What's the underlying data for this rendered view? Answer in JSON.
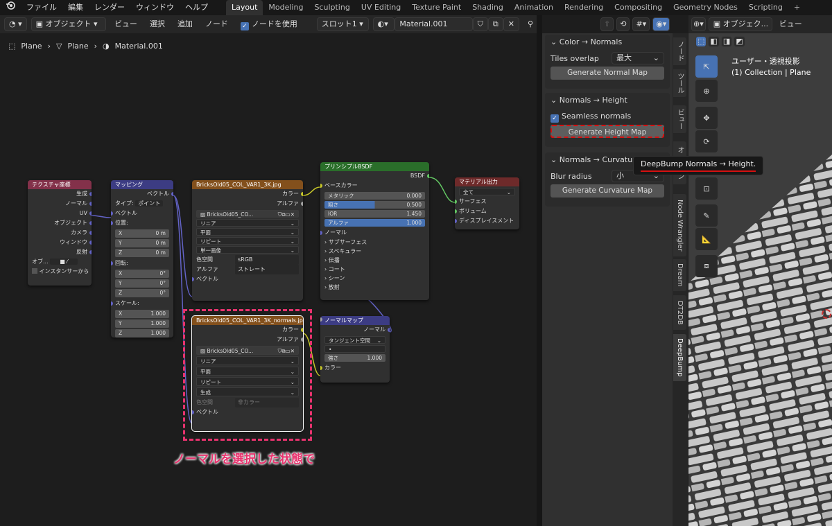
{
  "menu": [
    "ファイル",
    "編集",
    "レンダー",
    "ウィンドウ",
    "ヘルプ"
  ],
  "workspaces": [
    "Layout",
    "Modeling",
    "Sculpting",
    "UV Editing",
    "Texture Paint",
    "Shading",
    "Animation",
    "Rendering",
    "Compositing",
    "Geometry Nodes",
    "Scripting",
    "+"
  ],
  "header": {
    "mode": "オブジェクト",
    "view": "ビュー",
    "select": "選択",
    "add": "追加",
    "node": "ノード",
    "use_nodes": "ノードを使用",
    "slot": "スロット1",
    "material": "Material.001"
  },
  "breadcrumb": [
    "Plane",
    "Plane",
    "Material.001"
  ],
  "nodes": {
    "texcoord": {
      "title": "テクスチャ座標",
      "outputs": [
        "生成",
        "ノーマル",
        "UV",
        "オブジェクト",
        "カメラ",
        "ウィンドウ",
        "反射"
      ],
      "obj": "オブ...",
      "instancer": "インスタンサーから"
    },
    "mapping": {
      "title": "マッピング",
      "out": "ベクトル",
      "type_label": "タイプ:",
      "type_value": "ポイント",
      "vector": "ベクトル",
      "location": "位置:",
      "rotation": "回転:",
      "scale": "スケール:",
      "axes": [
        "X",
        "Y",
        "Z"
      ],
      "loc_vals": [
        "0 m",
        "0 m",
        "0 m"
      ],
      "rot_vals": [
        "0°",
        "0°",
        "0°"
      ],
      "scale_vals": [
        "1.000",
        "1.000",
        "1.000"
      ]
    },
    "img1": {
      "title": "BricksOld05_COL_VAR1_3K.jpg",
      "out_color": "カラー",
      "out_alpha": "アルファ",
      "file": "BricksOld05_CO...",
      "interp": "リニア",
      "proj": "平面",
      "ext": "リピート",
      "source": "単一画像",
      "cs_label": "色空間",
      "cs_value": "sRGB",
      "alpha_label": "アルファ",
      "alpha_value": "ストレート",
      "vector": "ベクトル"
    },
    "bsdf": {
      "title": "プリンシプルBSDF",
      "out": "BSDF",
      "base_color": "ベースカラー",
      "metallic": "メタリック",
      "metallic_v": "0.000",
      "rough": "粗さ",
      "rough_v": "0.500",
      "ior": "IOR",
      "ior_v": "1.450",
      "alpha": "アルファ",
      "alpha_v": "1.000",
      "normal": "ノーマル",
      "subs": [
        "サブサーフェス",
        "スペキュラー",
        "伝播",
        "コート",
        "シーン",
        "放射"
      ]
    },
    "output": {
      "title": "マテリアル出力",
      "target": "全て",
      "surface": "サーフェス",
      "volume": "ボリューム",
      "disp": "ディスプレイスメント"
    },
    "img2": {
      "title": "BricksOld05_COL_VAR1_3K_normals.jpg",
      "out_color": "カラー",
      "out_alpha": "アルファ",
      "file": "BricksOld05_CO...",
      "interp": "リニア",
      "proj": "平面",
      "ext": "リピート",
      "source": "生成",
      "cs_label": "色空間",
      "cs_value": "非カラー",
      "vector": "ベクトル"
    },
    "normalmap": {
      "title": "ノーマルマップ",
      "out": "ノーマル",
      "space": "タンジェント空間",
      "uvmap": "•",
      "strength": "強さ",
      "strength_v": "1.000",
      "color": "カラー"
    }
  },
  "annotation": "ノーマルを選択した状態で",
  "sidebar": {
    "p1": {
      "title": "Color → Normals",
      "tiles_label": "Tiles overlap",
      "tiles_value": "最大",
      "button": "Generate Normal Map"
    },
    "p2": {
      "title": "Normals → Height",
      "seamless": "Seamless normals",
      "button": "Generate Height Map"
    },
    "p3": {
      "title": "Normals → Curvature",
      "blur_label": "Blur radius",
      "blur_value": "小",
      "button": "Generate Curvature Map"
    }
  },
  "tooltip": "DeepBump Normals → Height.",
  "tabs": [
    "ノード",
    "ツール",
    "ビュー",
    "オ",
    "ン",
    "Node Wrangler",
    "Dream",
    "DT2DB",
    "DeepBump"
  ],
  "viewport": {
    "mode": "オブジェク...",
    "view": "ビュー",
    "label1": "ユーザー・透視投影",
    "label2": "(1) Collection | Plane"
  },
  "colors": {
    "accent": "#4772b3",
    "annotation": "#e8336e",
    "tooltip_underline": "#d61010"
  }
}
